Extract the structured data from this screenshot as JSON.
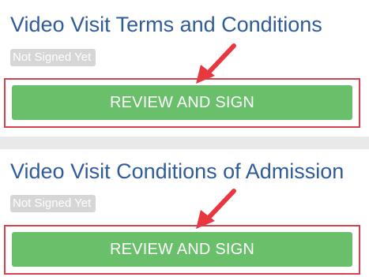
{
  "documents": [
    {
      "title": "Video Visit Terms and Conditions",
      "status": "Not Signed Yet",
      "button_label": "REVIEW AND SIGN"
    },
    {
      "title": "Video Visit Conditions of Admission",
      "status": "Not Signed Yet",
      "button_label": "REVIEW AND SIGN"
    }
  ],
  "colors": {
    "title": "#2f5c99",
    "button": "#6ac06a",
    "badge": "#d6d6d6",
    "highlight": "#d6404f",
    "arrow": "#e8373f"
  },
  "icons": {
    "annotation": "red-arrow-icon"
  }
}
